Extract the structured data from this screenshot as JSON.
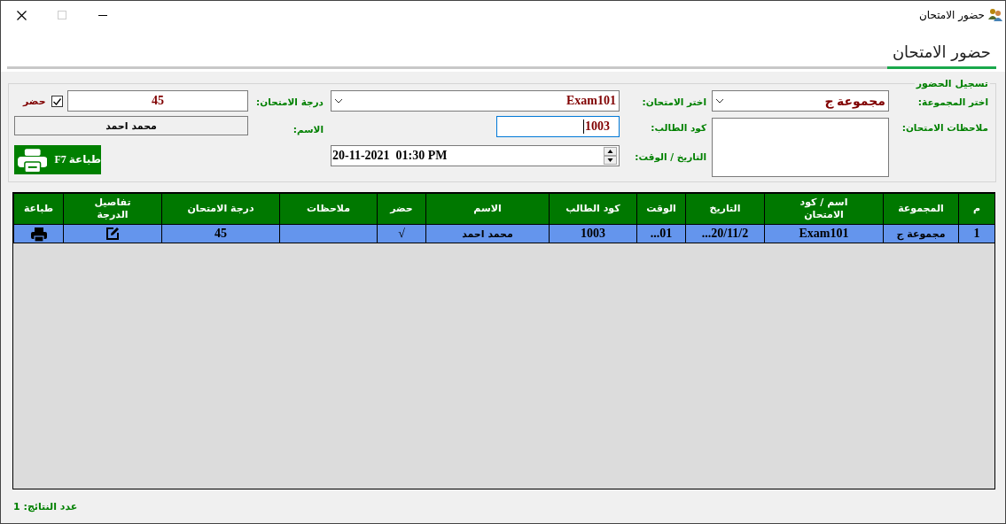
{
  "window": {
    "title": "حضور الامتحان"
  },
  "tab": {
    "label": "حضور الامتحان",
    "selected": true
  },
  "form": {
    "group": "تسجيل الحضور",
    "group_select": {
      "label": "اختر المجموعة:",
      "value": "مجموعة ج"
    },
    "exam_select": {
      "label": "اختر الامتحان:",
      "value": "Exam101"
    },
    "grade": {
      "label": "درجة الامتحان:",
      "value": "45"
    },
    "attended": {
      "label": "حضر",
      "checked": true
    },
    "notes": {
      "label": "ملاحظات الامتحان:"
    },
    "student_code": {
      "label": "كود الطالب:",
      "value": "1003",
      "focused": true
    },
    "name": {
      "label": "الاسم:",
      "value": "محمد احمد"
    },
    "datetime": {
      "label": "التاريخ / الوقت:",
      "value": "20-11-2021  01:30 PM"
    },
    "print_button": {
      "label": "طباعة F7"
    }
  },
  "table": {
    "columns": [
      "م",
      "المجموعة",
      "اسم / كود الامتحان",
      "التاريخ",
      "الوقت",
      "كود الطالب",
      "الاسم",
      "حضر",
      "ملاحظات",
      "درجة الامتحان",
      "تفاصيل الدرجة",
      "طباعة"
    ],
    "rows": [
      {
        "selected": true,
        "cells": [
          {
            "kind": "text",
            "text": "1"
          },
          {
            "kind": "text",
            "text": "مجموعة ج"
          },
          {
            "kind": "text",
            "text": "Exam101"
          },
          {
            "kind": "text",
            "text": "20/11/2..."
          },
          {
            "kind": "text",
            "text": "01..."
          },
          {
            "kind": "text",
            "text": "1003"
          },
          {
            "kind": "text",
            "text": "محمد احمد"
          },
          {
            "kind": "text",
            "text": "√"
          },
          {
            "kind": "empty"
          },
          {
            "kind": "text",
            "text": "45"
          },
          {
            "kind": "edit"
          },
          {
            "kind": "print"
          }
        ]
      }
    ]
  },
  "status": {
    "count": "عدد النتائج: 1"
  }
}
